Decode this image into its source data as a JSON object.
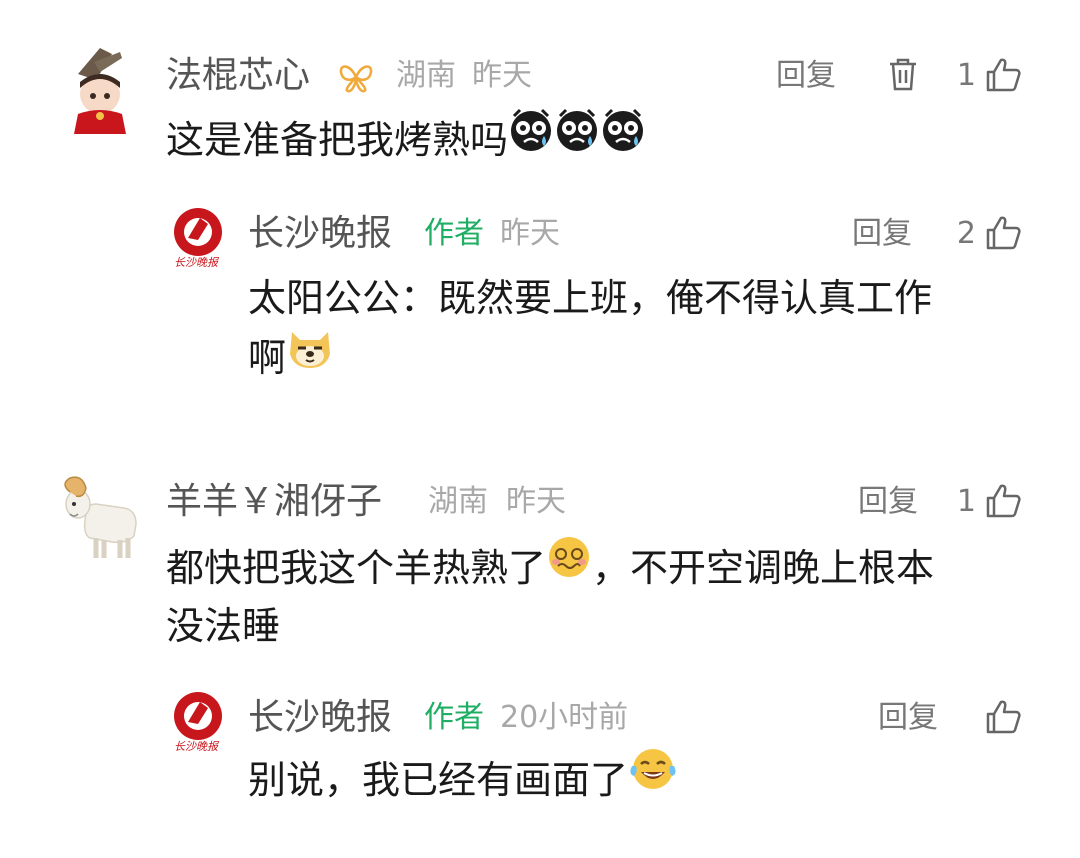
{
  "comments": [
    {
      "username": "法棍芯心",
      "location": "湖南",
      "time": "昨天",
      "reply_label": "回复",
      "like_count": "1",
      "text": "这是准备把我烤熟吗",
      "text_emojis": [
        "crying-face-emoji",
        "crying-face-emoji",
        "crying-face-emoji"
      ],
      "reply": {
        "username": "长沙晚报",
        "author_badge": "作者",
        "time": "昨天",
        "reply_label": "回复",
        "like_count": "2",
        "text_line1": "太阳公公：既然要上班，俺不得认真工作",
        "text_line2": "啊",
        "avatar_caption": "长沙晚报"
      }
    },
    {
      "username": "羊羊￥湘伢子",
      "location": "湖南",
      "time": "昨天",
      "reply_label": "回复",
      "like_count": "1",
      "text_line1_a": "都快把我这个羊热熟了",
      "text_line1_b": "，不开空调晚上根本",
      "text_line2": "没法睡",
      "reply": {
        "username": "长沙晚报",
        "author_badge": "作者",
        "time": "20小时前",
        "reply_label": "回复",
        "like_count": "",
        "text": "别说，我已经有画面了",
        "avatar_caption": "长沙晚报"
      }
    }
  ],
  "colors": {
    "author_badge": "#1fae63",
    "username": "#555555",
    "meta": "#a8a8a8",
    "brand_red": "#c8161d"
  }
}
